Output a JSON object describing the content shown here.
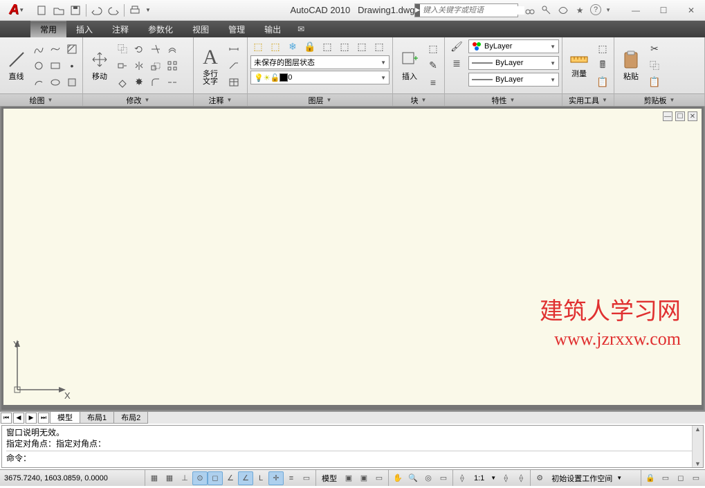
{
  "title": {
    "app": "AutoCAD 2010",
    "file": "Drawing1.dwg"
  },
  "search": {
    "placeholder": "键入关键字或短语"
  },
  "tabs": [
    "常用",
    "插入",
    "注释",
    "参数化",
    "视图",
    "管理",
    "输出"
  ],
  "active_tab": 0,
  "ribbon": {
    "draw": {
      "title": "绘图",
      "line_label": "直线"
    },
    "modify": {
      "title": "修改",
      "move_label": "移动"
    },
    "annot": {
      "title": "注释",
      "mtext_label": "多行\n文字"
    },
    "layer": {
      "title": "图层",
      "state": "未保存的图层状态",
      "current": "0"
    },
    "block": {
      "title": "块",
      "insert_label": "插入"
    },
    "props": {
      "title": "特性",
      "color": "ByLayer",
      "ltype": "ByLayer",
      "lweight": "ByLayer"
    },
    "util": {
      "title": "实用工具",
      "measure_label": "测量"
    },
    "clip": {
      "title": "剪贴板",
      "paste_label": "粘贴"
    }
  },
  "model_tabs": {
    "model": "模型",
    "layout1": "布局1",
    "layout2": "布局2"
  },
  "command": {
    "line1": "窗口说明无效。",
    "line2": "指定对角点：指定对角点：",
    "prompt": "命令："
  },
  "status": {
    "coords": "3675.7240, 1603.0859, 0.0000",
    "model_btn": "模型",
    "scale": "1:1",
    "workspace": "初始设置工作空间"
  },
  "ucs": {
    "x": "X",
    "y": "Y"
  },
  "watermark": {
    "l1": "建筑人学习网",
    "l2": "www.jzrxxw.com"
  }
}
